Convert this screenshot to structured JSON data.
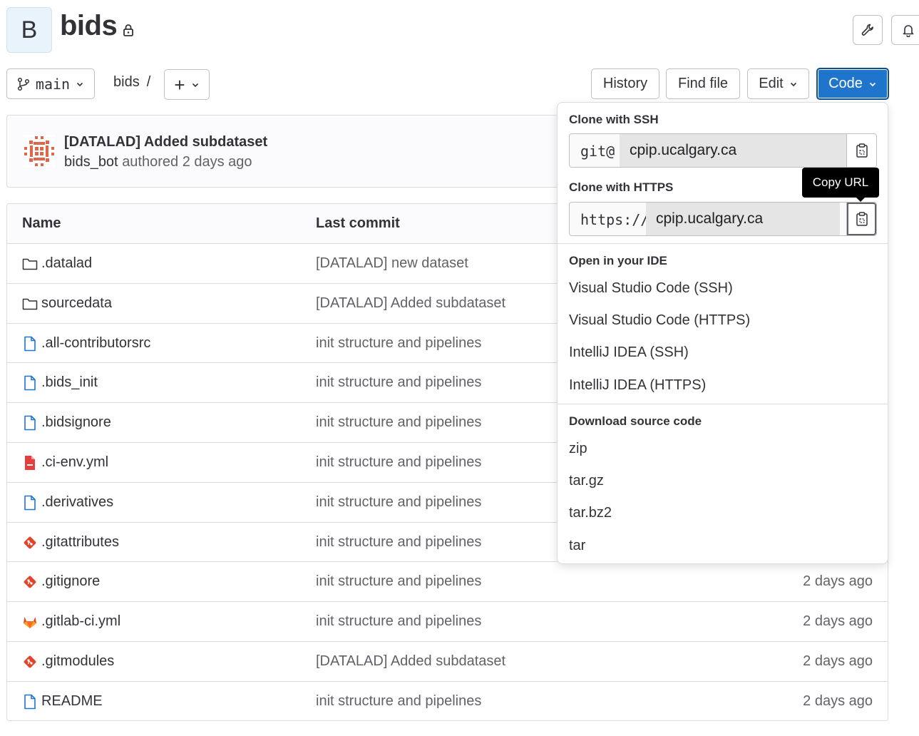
{
  "project": {
    "avatar_letter": "B",
    "title": "bids"
  },
  "toolbar": {
    "branch": "main",
    "breadcrumb_root": "bids",
    "breadcrumb_sep": "/",
    "add_label": "+",
    "history": "History",
    "find_file": "Find file",
    "edit": "Edit",
    "code": "Code"
  },
  "last_commit": {
    "title": "[DATALAD] Added subdataset",
    "author": "bids_bot",
    "meta": "authored 2 days ago"
  },
  "table": {
    "headers": {
      "name": "Name",
      "last_commit": "Last commit"
    },
    "rows": [
      {
        "name": ".datalad",
        "commit": "[DATALAD] new dataset",
        "date": "",
        "icon": "folder-icon"
      },
      {
        "name": "sourcedata",
        "commit": "[DATALAD] Added subdataset",
        "date": "",
        "icon": "folder-icon"
      },
      {
        "name": ".all-contributorsrc",
        "commit": "init structure and pipelines",
        "date": "",
        "icon": "file-icon"
      },
      {
        "name": ".bids_init",
        "commit": "init structure and pipelines",
        "date": "",
        "icon": "file-icon"
      },
      {
        "name": ".bidsignore",
        "commit": "init structure and pipelines",
        "date": "",
        "icon": "file-icon"
      },
      {
        "name": ".ci-env.yml",
        "commit": "init structure and pipelines",
        "date": "",
        "icon": "yaml-file-icon"
      },
      {
        "name": ".derivatives",
        "commit": "init structure and pipelines",
        "date": "",
        "icon": "file-icon"
      },
      {
        "name": ".gitattributes",
        "commit": "init structure and pipelines",
        "date": "",
        "icon": "git-icon"
      },
      {
        "name": ".gitignore",
        "commit": "init structure and pipelines",
        "date": "2 days ago",
        "icon": "git-icon"
      },
      {
        "name": ".gitlab-ci.yml",
        "commit": "init structure and pipelines",
        "date": "2 days ago",
        "icon": "gitlab-icon"
      },
      {
        "name": ".gitmodules",
        "commit": "[DATALAD] Added subdataset",
        "date": "2 days ago",
        "icon": "git-icon"
      },
      {
        "name": "README",
        "commit": "init structure and pipelines",
        "date": "2 days ago",
        "icon": "file-icon"
      }
    ]
  },
  "code_dropdown": {
    "ssh_heading": "Clone with SSH",
    "ssh_prefix": "git@",
    "ssh_host": "cpip.ucalgary.ca",
    "https_heading": "Clone with HTTPS",
    "https_prefix": "https://",
    "https_host": "cpip.ucalgary.ca",
    "ide_heading": "Open in your IDE",
    "ide_items": [
      "Visual Studio Code (SSH)",
      "Visual Studio Code (HTTPS)",
      "IntelliJ IDEA (SSH)",
      "IntelliJ IDEA (HTTPS)"
    ],
    "download_heading": "Download source code",
    "download_items": [
      "zip",
      "tar.gz",
      "tar.bz2",
      "tar"
    ]
  },
  "tooltip": "Copy URL",
  "colors": {
    "primary": "#1f75cb",
    "primary_border": "#0b5cad",
    "text": "#333238",
    "muted": "#626168",
    "file_icon": "#1f75cb",
    "git_icon": "#e24329",
    "yaml_icon": "#dd2b0e"
  }
}
